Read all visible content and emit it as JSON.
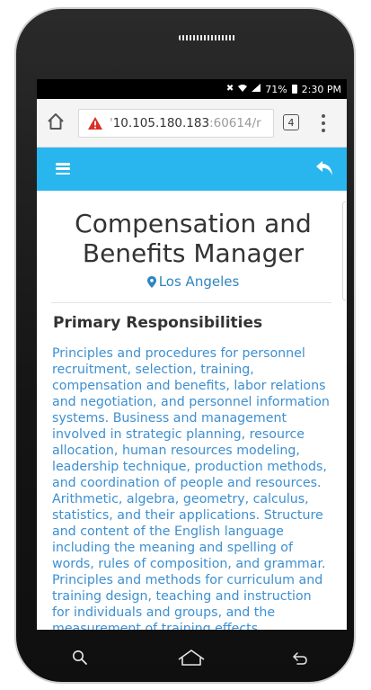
{
  "status_bar": {
    "battery": "71%",
    "time": "2:30 PM"
  },
  "browser": {
    "url_host": "10.105.180.183",
    "url_rest": ":60614/r",
    "url_prefix": "'",
    "tab_count": "4",
    "icons": [
      "home-icon",
      "warning-icon",
      "tabs-icon",
      "more-vert-icon"
    ]
  },
  "app_header": {
    "icons": [
      "menu-icon",
      "reply-icon"
    ],
    "color": "#29b6ef"
  },
  "job": {
    "title": "Compensation and Benefits Manager",
    "location": "Los Angeles"
  },
  "section": {
    "heading": "Primary Responsibilities",
    "body": "Principles and procedures for personnel recruitment, selection, training, compensation and benefits, labor relations and negotiation, and personnel information systems. Business and management involved in strategic planning, resource allocation, human resources modeling, leadership technique, production methods, and coordination of people and resources. Arithmetic, algebra, geometry, calculus, statistics, and their applications. Structure and content of the English language including the meaning and spelling of words, rules of composition, and grammar. Principles and methods for curriculum and training design, teaching and instruction for individuals and groups, and the measurement of training effects."
  },
  "colors": {
    "link_blue": "#3d8fd0",
    "location_blue": "#2e86c1",
    "title_gray": "#333333"
  }
}
